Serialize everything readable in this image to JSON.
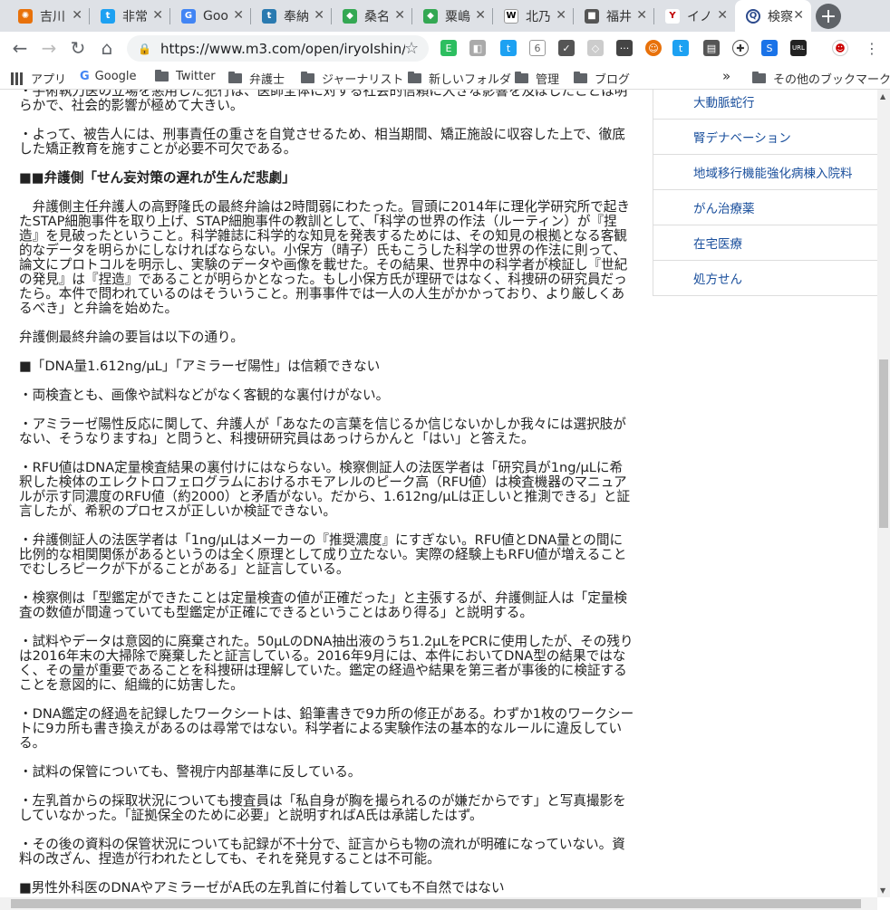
{
  "tabs": [
    {
      "title": "吉川",
      "icon": "sun-icon",
      "color": "#e8710a"
    },
    {
      "title": "非常",
      "icon": "twitter-icon",
      "color": "#1da1f2"
    },
    {
      "title": "Goo",
      "icon": "google-translate-icon",
      "color": "#4285f4"
    },
    {
      "title": "奉納",
      "icon": "t-icon",
      "color": "#2a7ab0"
    },
    {
      "title": "桑名",
      "icon": "maps-icon",
      "color": "#34a853"
    },
    {
      "title": "粟嶋",
      "icon": "maps-icon",
      "color": "#34a853"
    },
    {
      "title": "北乃",
      "icon": "wikipedia-icon",
      "color": "#333333"
    },
    {
      "title": "福井",
      "icon": "news-icon",
      "color": "#555555"
    },
    {
      "title": "イノ",
      "icon": "yomiuri-icon",
      "color": "#c00000"
    },
    {
      "title": "検察",
      "icon": "m3-icon",
      "color": "#2c4a8c"
    }
  ],
  "omnibox": {
    "url": "https://www.m3.com/open/iryoIshin/..."
  },
  "bookmarks": {
    "apps": "アプリ",
    "items": [
      "Google",
      "Twitter",
      "弁護士",
      "ジャーナリスト",
      "新しいフォルダ",
      "管理",
      "ブログ"
    ],
    "overflow": "»",
    "other": "その他のブックマーク"
  },
  "article": {
    "p0": "・手術執刀医の立場を悪用した犯行は、医師全体に対する社会的信頼に大きな影響を及ぼしたことは明らかで、社会的影響が極めて大きい。",
    "p1": "・よって、被告人には、刑事責任の重さを自覚させるため、相当期間、矯正施設に収容した上で、徹底した矯正教育を施すことが必要不可欠である。",
    "h1": "■■弁護側「せん妄対策の遅れが生んだ悲劇」",
    "p2": "　弁護側主任弁護人の高野隆氏の最終弁論は2時間弱にわたった。冒頭に2014年に理化学研究所で起きたSTAP細胞事件を取り上げ、STAP細胞事件の教訓として、「科学の世界の作法（ルーティン）が『捏造』を見破ったということ。科学雑誌に科学的な知見を発表するためには、その知見の根拠となる客観的なデータを明らかにしなければならない。小保方（晴子）氏もこうした科学の世界の作法に則って、論文にプロトコルを明示し、実験のデータや画像を載せた。その結果、世界中の科学者が検証し『世紀の発見』は『捏造』であることが明らかとなった。もし小保方氏が理研ではなく、科捜研の研究員だったら。本件で問われているのはそういうこと。刑事事件では一人の人生がかかっており、より厳しくあるべき」と弁論を始めた。",
    "p3": "弁護側最終弁論の要旨は以下の通り。",
    "p4": "■「DNA量1.612ng/μL」「アミラーゼ陽性」は信頼できない",
    "p5": "・両検査とも、画像や試料などがなく客観的な裏付けがない。",
    "p6": "・アミラーゼ陽性反応に関して、弁護人が「あなたの言葉を信じるか信じないかしか我々には選択肢がない、そうなりますね」と問うと、科捜研研究員はあっけらかんと「はい」と答えた。",
    "p7": "・RFU値はDNA定量検査結果の裏付けにはならない。検察側証人の法医学者は「研究員が1ng/μLに希釈した検体のエレクトロフェログラムにおけるホモアレルのピーク高（RFU値）は検査機器のマニュアルが示す同濃度のRFU値（約2000）と矛盾がない。だから、1.612ng/μLは正しいと推測できる」と証言したが、希釈のプロセスが正しいか検証できない。",
    "p8": "・弁護側証人の法医学者は「1ng/μLはメーカーの『推奨濃度』にすぎない。RFU値とDNA量との間に比例的な相関関係があるというのは全く原理として成り立たない。実際の経験上もRFU値が増えることでむしろピークが下がることがある」と証言している。",
    "p9": "・検察側は「型鑑定ができたことは定量検査の値が正確だった」と主張するが、弁護側証人は「定量検査の数値が間違っていても型鑑定が正確にできるということはあり得る」と説明する。",
    "p10": "・試料やデータは意図的に廃棄された。50μLのDNA抽出液のうち1.2μLをPCRに使用したが、その残りは2016年末の大掃除で廃棄したと証言している。2016年9月には、本件においてDNA型の結果ではなく、その量が重要であることを科捜研は理解していた。鑑定の経過や結果を第三者が事後的に検証することを意図的に、組織的に妨害した。",
    "p11": "・DNA鑑定の経過を記録したワークシートは、鉛筆書きで9カ所の修正がある。わずか1枚のワークシートに9カ所も書き換えがあるのは尋常ではない。科学者による実験作法の基本的なルールに違反している。",
    "p12": "・試料の保管についても、警視庁内部基準に反している。",
    "p13": "・左乳首からの採取状況についても捜査員は「私自身が胸を撮られるのが嫌だからです」と写真撮影をしていなかった。「証拠保全のために必要」と説明すればA氏は承諾したはず。",
    "p14": "・その後の資料の保管状況についても記録が不十分で、証言からも物の流れが明確になっていない。資料の改ざん、捏造が行われたとしても、それを発見することは不可能。",
    "p15": "■男性外科医のDNAやアミラーゼがA氏の左乳首に付着していても不自然ではない"
  },
  "sidebar": {
    "items": [
      "大動脈蛇行",
      "腎デナベーション",
      "地域移行機能強化病棟入院料",
      "がん治療薬",
      "在宅医療",
      "処方せん"
    ]
  }
}
